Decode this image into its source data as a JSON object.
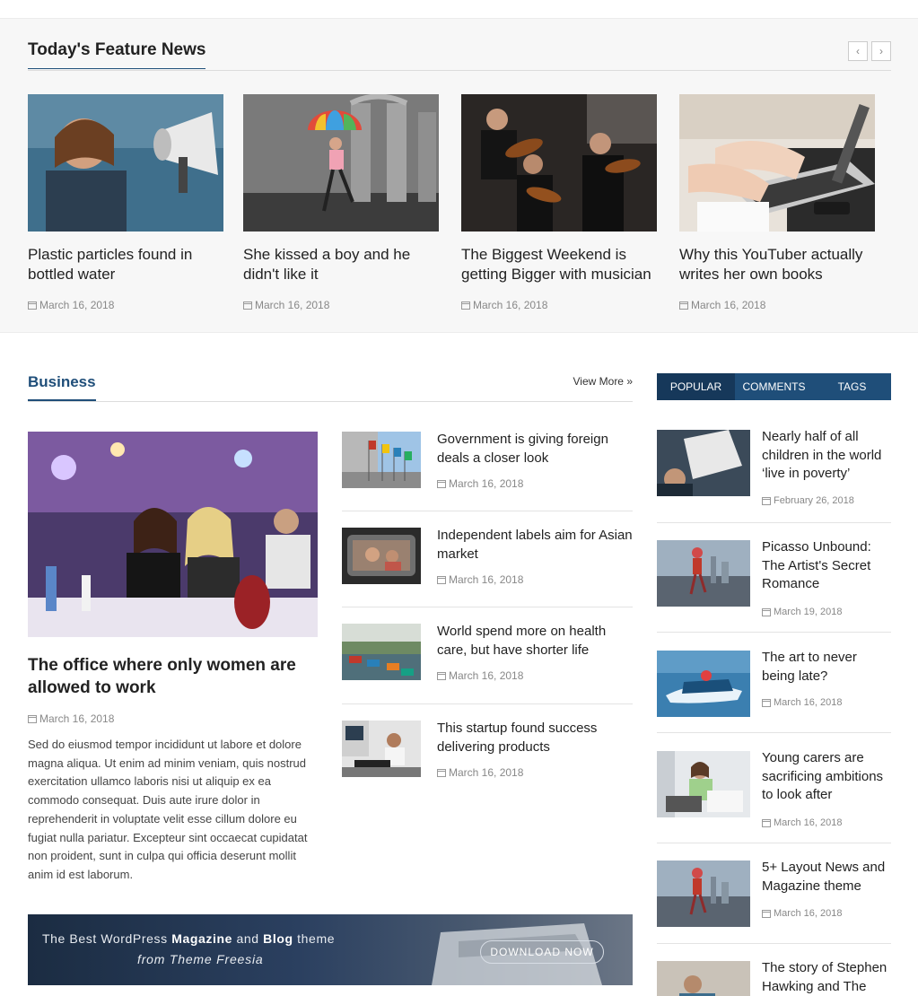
{
  "feature": {
    "title": "Today's Feature News",
    "prev_icon": "chevron-left-icon",
    "next_icon": "chevron-right-icon",
    "prev_glyph": "‹",
    "next_glyph": "›",
    "articles": [
      {
        "title": "Plastic particles found in bottled water",
        "date": "March 16, 2018"
      },
      {
        "title": "She kissed a boy and he didn't like it",
        "date": "March 16, 2018"
      },
      {
        "title": "The Biggest Weekend is getting Bigger with musician",
        "date": "March 16, 2018"
      },
      {
        "title": "Why this YouTuber actually writes her own books",
        "date": "March 16, 2018"
      }
    ]
  },
  "business": {
    "title": "Business",
    "view_more": "View More »",
    "main": {
      "title": "The office where only women are allowed to work",
      "date": "March 16, 2018",
      "excerpt": "Sed do eiusmod tempor incididunt ut labore et dolore magna aliqua. Ut enim ad minim veniam, quis nostrud exercitation ullamco laboris nisi ut aliquip ex ea commodo consequat. Duis aute irure dolor in reprehenderit in voluptate velit esse cillum dolore eu fugiat nulla pariatur. Excepteur sint occaecat cupidatat non proident, sunt in culpa qui officia deserunt mollit anim id est laborum."
    },
    "list": [
      {
        "title": "Government is giving foreign deals a closer look",
        "date": "March 16, 2018"
      },
      {
        "title": "Independent labels aim for Asian market",
        "date": "March 16, 2018"
      },
      {
        "title": "World spend more on health care, but have shorter life",
        "date": "March 16, 2018"
      },
      {
        "title": "This startup found success delivering products",
        "date": "March 16, 2018"
      }
    ]
  },
  "banner": {
    "line1_a": "The Best WordPress ",
    "line1_b": "Magazine",
    "line1_c": " and ",
    "line1_d": "Blog",
    "line1_e": " theme",
    "line2": "from Theme Freesia",
    "button": "DOWNLOAD NOW"
  },
  "sidebar": {
    "tabs": [
      "POPULAR",
      "COMMENTS",
      "TAGS"
    ],
    "active_tab": "POPULAR",
    "items": [
      {
        "title": "Nearly half of all children in the world ‘live in poverty’",
        "date": "February 26, 2018"
      },
      {
        "title": "Picasso Unbound: The Artist's Secret Romance",
        "date": "March 19, 2018"
      },
      {
        "title": "The art to never being late?",
        "date": "March 16, 2018"
      },
      {
        "title": "Young carers are sacrificing ambitions to look after",
        "date": "March 16, 2018"
      },
      {
        "title": "5+ Layout News and Magazine theme",
        "date": "March 16, 2018"
      },
      {
        "title": "The story of Stephen Hawking and The",
        "date": ""
      }
    ]
  },
  "colors": {
    "accent": "#1f4e79",
    "tab_active": "#16385a",
    "feature_bg": "#f7f7f7",
    "meta": "#888888"
  }
}
